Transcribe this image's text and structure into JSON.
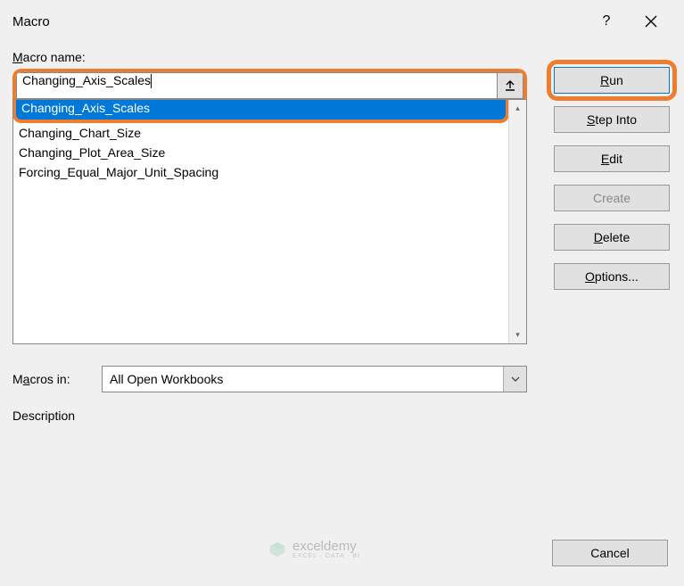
{
  "title": "Macro",
  "labels": {
    "macroName": "Macro name:",
    "macrosIn": "Macros in:",
    "description": "Description"
  },
  "input": {
    "value": "Changing_Axis_Scales"
  },
  "list": [
    "Changing_Axis_Scales",
    "Changing_Chart_Size",
    "Changing_Plot_Area_Size",
    "Forcing_Equal_Major_Unit_Spacing"
  ],
  "selectedIndex": 0,
  "macrosInValue": "All Open Workbooks",
  "buttons": {
    "run": "Run",
    "stepInto": "Step Into",
    "edit": "Edit",
    "create": "Create",
    "delete": "Delete",
    "options": "Options...",
    "cancel": "Cancel"
  },
  "watermark": {
    "name": "exceldemy",
    "sub": "EXCEL · DATA · BI"
  }
}
